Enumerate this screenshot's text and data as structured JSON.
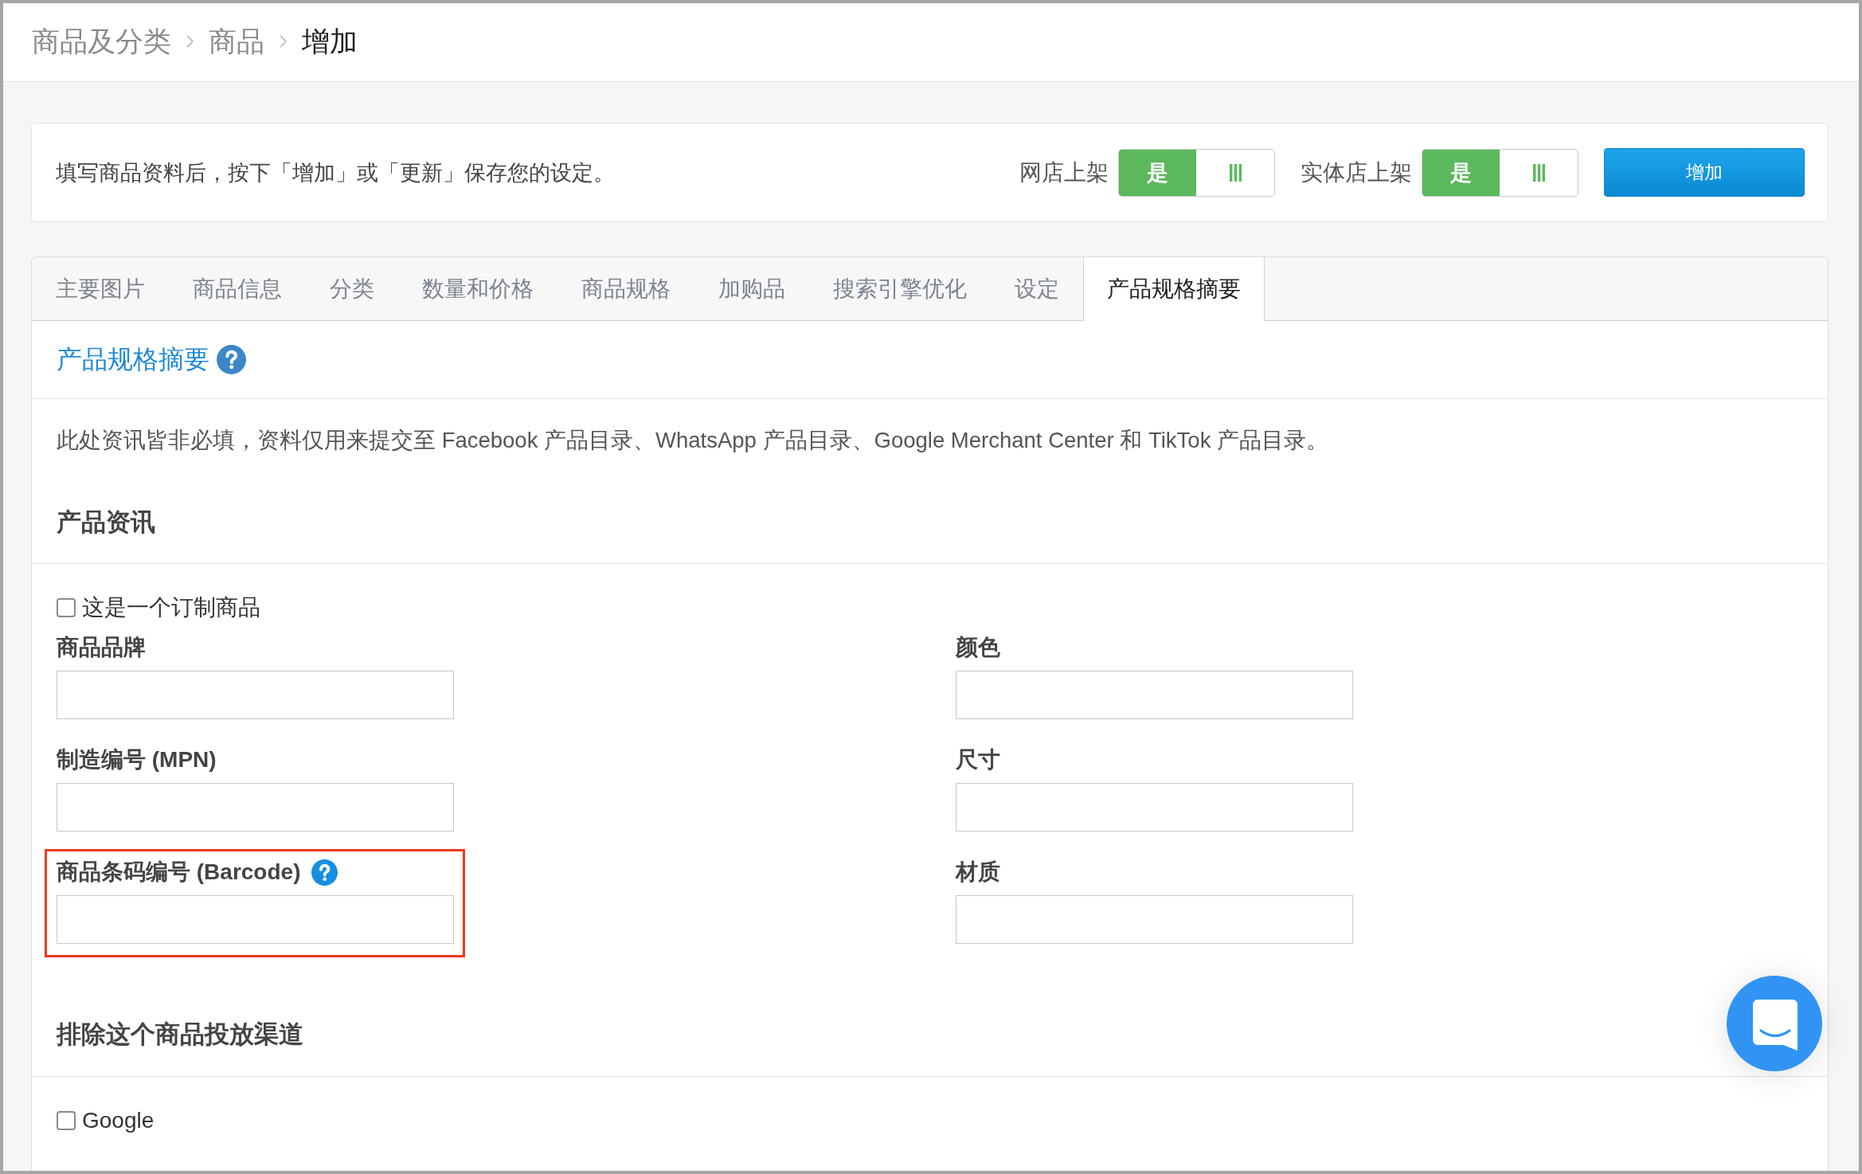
{
  "breadcrumb": [
    {
      "label": "商品及分类",
      "current": false
    },
    {
      "label": "商品",
      "current": false
    },
    {
      "label": "增加",
      "current": true
    }
  ],
  "notice_bar": {
    "message": "填写商品资料后，按下「增加」或「更新」保存您的设定。",
    "toggles": [
      {
        "label": "网店上架",
        "on_text": "是",
        "on": true
      },
      {
        "label": "实体店上架",
        "on_text": "是",
        "on": true
      }
    ],
    "primary_button": "增加"
  },
  "tabs": [
    {
      "label": "主要图片",
      "selected": false
    },
    {
      "label": "商品信息",
      "selected": false
    },
    {
      "label": "分类",
      "selected": false
    },
    {
      "label": "数量和价格",
      "selected": false
    },
    {
      "label": "商品规格",
      "selected": false
    },
    {
      "label": "加购品",
      "selected": false
    },
    {
      "label": "搜索引擎优化",
      "selected": false
    },
    {
      "label": "设定",
      "selected": false
    },
    {
      "label": "产品规格摘要",
      "selected": true
    }
  ],
  "section": {
    "title": "产品规格摘要",
    "help": true,
    "description": "此处资讯皆非必填，资料仅用来提交至 Facebook 产品目录、WhatsApp 产品目录、Google Merchant Center 和 TikTok 产品目录。"
  },
  "product_info": {
    "title": "产品资讯",
    "custom_option": {
      "label": "这是一个订制商品",
      "checked": false
    },
    "columns": [
      [
        {
          "label": "商品品牌",
          "help": false,
          "highlighted": false
        },
        {
          "label": "制造编号 (MPN)",
          "help": false,
          "highlighted": false
        },
        {
          "label": "商品条码编号 (Barcode)",
          "help": true,
          "highlighted": true
        }
      ],
      [
        {
          "label": "颜色",
          "help": false,
          "highlighted": false
        },
        {
          "label": "尺寸",
          "help": false,
          "highlighted": false
        },
        {
          "label": "材质",
          "help": false,
          "highlighted": false
        }
      ]
    ]
  },
  "exclude_channels": {
    "title": "排除这个商品投放渠道",
    "options": [
      {
        "label": "Google",
        "checked": false
      }
    ]
  }
}
